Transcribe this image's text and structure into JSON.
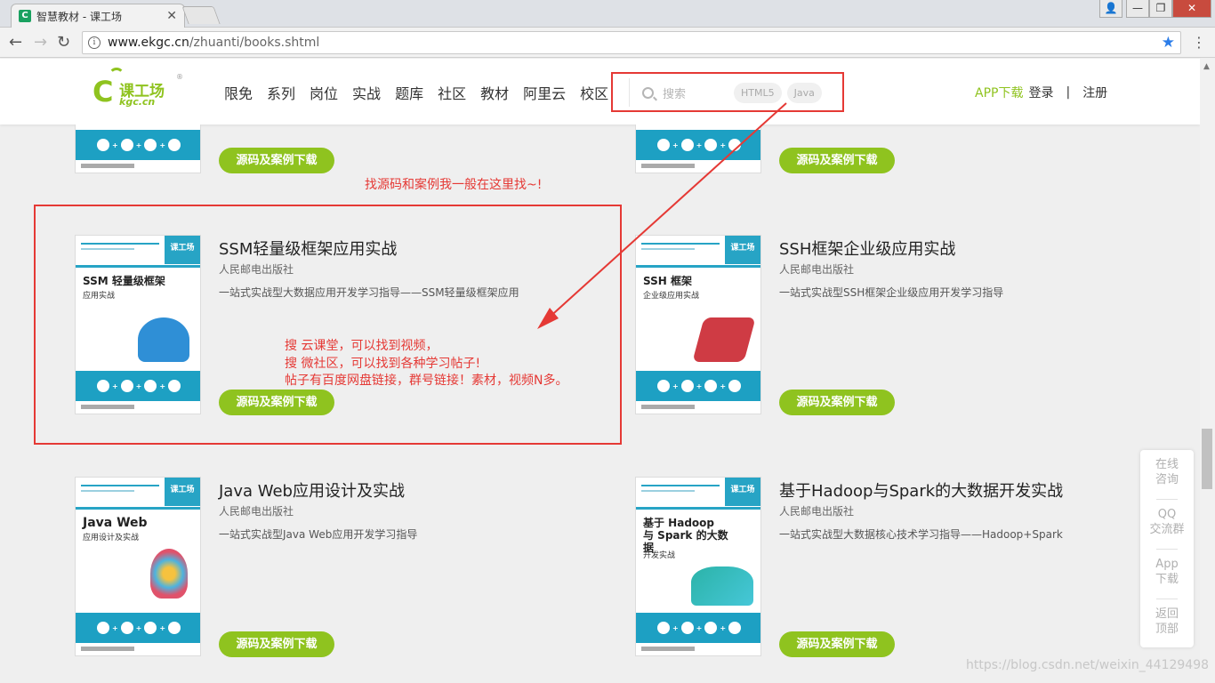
{
  "browser": {
    "tab_title": "智慧教材 - 课工场",
    "favicon_letter": "C",
    "close_glyph": "✕",
    "url_host": "www.ekgc.cn",
    "url_path": "/zhuanti/books.shtml",
    "back_glyph": "←",
    "forward_glyph": "→",
    "reload_glyph": "↻",
    "star_glyph": "★",
    "menu_glyph": "⋮",
    "win_user_glyph": "👤",
    "win_min_glyph": "—",
    "win_max_glyph": "❐",
    "win_close_glyph": "✕"
  },
  "header": {
    "logo_cn": "课工场",
    "logo_en": "kgc.cn",
    "logo_mark": "®",
    "nav": [
      "限免",
      "系列",
      "岗位",
      "实战",
      "题库",
      "社区",
      "教材",
      "阿里云",
      "校区"
    ],
    "search_placeholder": "搜索",
    "search_tags": [
      "HTML5",
      "Java"
    ],
    "app_download": "APP下载",
    "login": "登录",
    "separator": "|",
    "register": "注册"
  },
  "download_label": "源码及案例下载",
  "books": [
    {
      "title": "SSM轻量级框架应用实战",
      "publisher": "人民邮电出版社",
      "desc": "一站式实战型大数据应用开发学习指导——SSM轻量级框架应用",
      "cover_title": "SSM 轻量级框架",
      "cover_sub": "应用实战"
    },
    {
      "title": "SSH框架企业级应用实战",
      "publisher": "人民邮电出版社",
      "desc": "一站式实战型SSH框架企业级应用开发学习指导",
      "cover_title": "SSH 框架",
      "cover_sub": "企业级应用实战"
    },
    {
      "title": "Java Web应用设计及实战",
      "publisher": "人民邮电出版社",
      "desc": "一站式实战型Java Web应用开发学习指导",
      "cover_title": "Java Web",
      "cover_sub": "应用设计及实战"
    },
    {
      "title": "基于Hadoop与Spark的大数据开发实战",
      "publisher": "人民邮电出版社",
      "desc": "一站式实战型大数据核心技术学习指导——Hadoop+Spark",
      "cover_title": "基于 Hadoop 与 Spark 的大数据",
      "cover_sub": "开发实战"
    }
  ],
  "cover_badge": "课工场",
  "annotations": {
    "note_top": "找源码和案例我一般在这里找~!",
    "note_lines": [
      "搜   云课堂，可以找到视频，",
      "搜   微社区，可以找到各种学习帖子!",
      "帖子有百度网盘链接，群号链接！素材，视频N多。"
    ],
    "color": "#e53935"
  },
  "float_bar": [
    "在线\n咨询",
    "QQ\n交流群",
    "App\n下载",
    "返回\n顶部"
  ],
  "float_bar_lines": [
    [
      "在线",
      "咨询"
    ],
    [
      "QQ",
      "交流群"
    ],
    [
      "App",
      "下载"
    ],
    [
      "返回",
      "顶部"
    ]
  ],
  "watermark": "https://blog.csdn.net/weixin_44129498",
  "colors": {
    "brand_green": "#8fc31f",
    "cover_blue": "#1da0c3",
    "annotation_red": "#e53935"
  }
}
